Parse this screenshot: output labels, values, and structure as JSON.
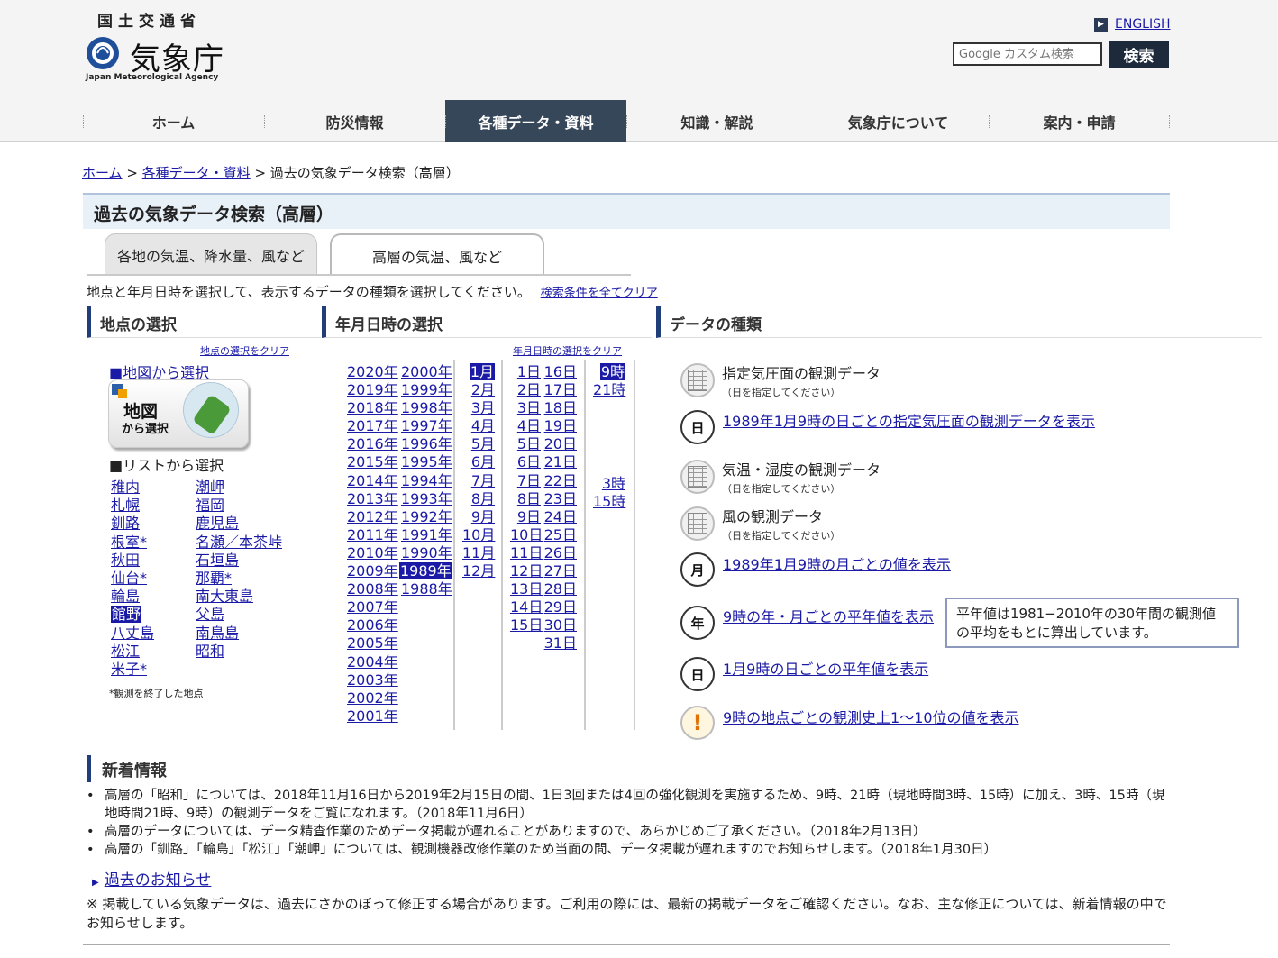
{
  "header": {
    "ministry": "国土交通省",
    "agency_name": "気象庁",
    "agency_en": "Japan Meteorological Agency",
    "english_link": "ENGLISH",
    "search_placeholder": "Google カスタム検索",
    "search_button": "検索"
  },
  "nav": [
    {
      "label": "ホーム"
    },
    {
      "label": "防災情報"
    },
    {
      "label": "各種データ・資料"
    },
    {
      "label": "知識・解説"
    },
    {
      "label": "気象庁について"
    },
    {
      "label": "案内・申請"
    }
  ],
  "breadcrumb": {
    "home": "ホーム",
    "sep": " > ",
    "data": "各種データ・資料",
    "current": "過去の気象データ検索（高層）"
  },
  "page_title": "過去の気象データ検索（高層）",
  "tabs": {
    "inactive": "各地の気温、降水量、風など",
    "active": "高層の気温、風など"
  },
  "instruction": {
    "text": "地点と年月日時を選択して、表示するデータの種類を選択してください。",
    "clear_all": "検索条件を全てクリア"
  },
  "sections": {
    "point": "地点の選択",
    "date": "年月日時の選択",
    "type": "データの種類"
  },
  "point": {
    "clear": "地点の選択をクリア",
    "map_link": "■地図から選択",
    "map_image_line1": "地図",
    "map_image_line2": "から選択",
    "list_heading": "■リストから選択",
    "stations_a": [
      "稚内",
      "札幌",
      "釧路",
      "根室*",
      "秋田",
      "仙台*",
      "輪島",
      "館野",
      "八丈島",
      "松江",
      "米子*"
    ],
    "stations_b": [
      "潮岬",
      "福岡",
      "鹿児島",
      "名瀬／本茶峠",
      "石垣島",
      "那覇*",
      "南大東島",
      "父島",
      "南鳥島",
      "昭和"
    ],
    "selected_station": "館野",
    "note": "*観測を終了した地点"
  },
  "date": {
    "clear": "年月日時の選択をクリア",
    "years_a": [
      "2020年",
      "2019年",
      "2018年",
      "2017年",
      "2016年",
      "2015年",
      "2014年",
      "2013年",
      "2012年",
      "2011年",
      "2010年",
      "2009年",
      "2008年",
      "2007年",
      "2006年",
      "2005年",
      "2004年",
      "2003年",
      "2002年",
      "2001年"
    ],
    "years_b": [
      "2000年",
      "1999年",
      "1998年",
      "1997年",
      "1996年",
      "1995年",
      "1994年",
      "1993年",
      "1992年",
      "1991年",
      "1990年",
      "1989年",
      "1988年"
    ],
    "selected_year": "1989年",
    "months": [
      "1月",
      "2月",
      "3月",
      "4月",
      "5月",
      "6月",
      "7月",
      "8月",
      "9月",
      "10月",
      "11月",
      "12月"
    ],
    "selected_month": "1月",
    "days_a": [
      "1日",
      "2日",
      "3日",
      "4日",
      "5日",
      "6日",
      "7日",
      "8日",
      "9日",
      "10日",
      "11日",
      "12日",
      "13日",
      "14日",
      "15日"
    ],
    "days_b": [
      "16日",
      "17日",
      "18日",
      "19日",
      "20日",
      "21日",
      "22日",
      "23日",
      "24日",
      "25日",
      "26日",
      "27日",
      "28日",
      "29日",
      "30日",
      "31日"
    ],
    "hours_main": [
      "9時",
      "21時"
    ],
    "hours_extra": [
      "3時",
      "15時"
    ],
    "selected_hour": "9時"
  },
  "types": {
    "pressure_label": "指定気圧面の観測データ",
    "pressure_note": "（日を指定してください）",
    "pressure_daily_link": "1989年1月9時の日ごとの指定気圧面の観測データを表示",
    "temp_label": "気温・湿度の観測データ",
    "temp_note": "（日を指定してください）",
    "wind_label": "風の観測データ",
    "wind_note": "（日を指定してください）",
    "monthly_link": "1989年1月9時の月ごとの値を表示",
    "normal_ym_link": "9時の年・月ごとの平年値を表示",
    "normal_note": "平年値は1981−2010年の30年間の観測値の平均をもとに算出しています。",
    "normal_daily_link": "1月9時の日ごとの平年値を表示",
    "rank_link": "9時の地点ごとの観測史上1〜10位の値を表示",
    "icon_day": "日",
    "icon_month": "月",
    "icon_year": "年",
    "icon_warn": "!"
  },
  "news": {
    "heading": "新着情報",
    "items": [
      "高層の「昭和」については、2018年11月16日から2019年2月15日の間、1日3回または4回の強化観測を実施するため、9時、21時（現地時間3時、15時）に加え、3時、15時（現地時間21時、9時）の観測データをご覧になれます。（2018年11月6日）",
      "高層のデータについては、データ精査作業のためデータ掲載が遅れることがありますので、あらかじめご了承ください。（2018年2月13日）",
      "高層の「釧路」「輪島」「松江」「潮岬」については、観測機器改修作業のため当面の間、データ掲載が遅れますのでお知らせします。（2018年1月30日）"
    ],
    "past_link": "過去のお知らせ"
  },
  "footnote": "※ 掲載している気象データは、過去にさかのぼって修正する場合があります。ご利用の際には、最新の掲載データをご確認ください。なお、主な修正については、新着情報の中でお知らせします。",
  "colors": {
    "link": "#1a1aa6",
    "nav_active": "#37475a",
    "section_bar": "#1f3e7a",
    "title_bg": "#e8f0f8"
  }
}
